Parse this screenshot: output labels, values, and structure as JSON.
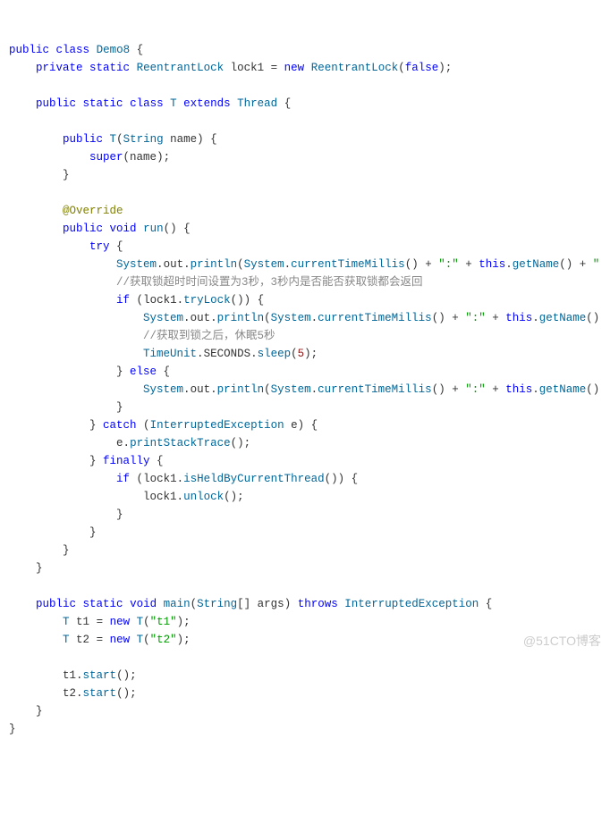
{
  "code": {
    "l1": {
      "a": "public",
      "b": "class",
      "c": "Demo8"
    },
    "l2": {
      "a": "private",
      "b": "static",
      "c": "ReentrantLock",
      "d": "lock1",
      "e": "new",
      "f": "ReentrantLock",
      "g": "false"
    },
    "l3": {
      "a": "public",
      "b": "static",
      "c": "class",
      "d": "T",
      "e": "extends",
      "f": "Thread"
    },
    "l4": {
      "a": "public",
      "b": "T",
      "c": "String",
      "d": "name"
    },
    "l5": {
      "a": "super",
      "b": "name"
    },
    "l6": {
      "a": "@Override"
    },
    "l7": {
      "a": "public",
      "b": "void",
      "c": "run"
    },
    "l8": {
      "a": "try"
    },
    "l9": {
      "a": "System",
      "b": "out",
      "c": "println",
      "d": "System",
      "e": "currentTimeMillis",
      "f": "\":\"",
      "g": "this",
      "h": "getName"
    },
    "l10": {
      "a": "//获取锁超时时间设置为3秒，3秒内是否能否获取锁都会返回"
    },
    "l11": {
      "a": "if",
      "b": "lock1",
      "c": "tryLock"
    },
    "l12": {
      "a": "System",
      "b": "out",
      "c": "println",
      "d": "System",
      "e": "currentTimeMillis",
      "f": "\":\"",
      "g": "this",
      "h": "getName"
    },
    "l13": {
      "a": "//获取到锁之后，休眠5秒"
    },
    "l14": {
      "a": "TimeUnit",
      "b": "SECONDS",
      "c": "sleep",
      "d": "5"
    },
    "l15": {
      "a": "else"
    },
    "l16": {
      "a": "System",
      "b": "out",
      "c": "println",
      "d": "System",
      "e": "currentTimeMillis",
      "f": "\":\"",
      "g": "this",
      "h": "getName"
    },
    "l17": {
      "a": "catch",
      "b": "InterruptedException",
      "c": "e"
    },
    "l18": {
      "a": "e",
      "b": "printStackTrace"
    },
    "l19": {
      "a": "finally"
    },
    "l20": {
      "a": "if",
      "b": "lock1",
      "c": "isHeldByCurrentThread"
    },
    "l21": {
      "a": "lock1",
      "b": "unlock"
    },
    "l22": {
      "a": "public",
      "b": "static",
      "c": "void",
      "d": "main",
      "e": "String",
      "f": "args",
      "g": "throws",
      "h": "InterruptedException"
    },
    "l23": {
      "a": "T",
      "b": "t1",
      "c": "new",
      "d": "T",
      "e": "\"t1\""
    },
    "l24": {
      "a": "T",
      "b": "t2",
      "c": "new",
      "d": "T",
      "e": "\"t2\""
    },
    "l25": {
      "a": "t1",
      "b": "start"
    },
    "l26": {
      "a": "t2",
      "b": "start"
    }
  },
  "watermark": "@51CTO博客"
}
